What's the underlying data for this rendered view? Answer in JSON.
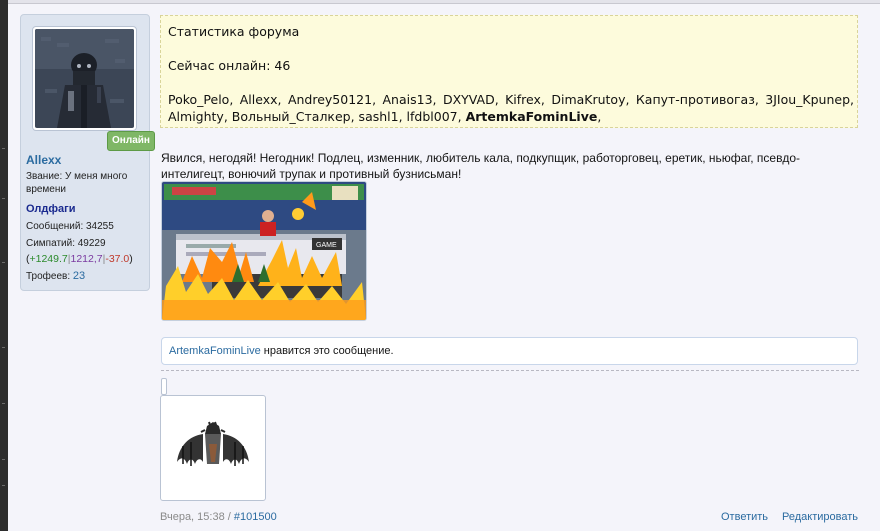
{
  "user": {
    "name": "Allexx",
    "status_label": "Звание: У меня много времени",
    "group": "Олдфаги",
    "messages": "Сообщений: 34255",
    "likes": "Симпатий: 49229",
    "rep_open": "(",
    "rep_plus": "+1249.7",
    "rep_mid": "1212,7",
    "rep_minus": "-37.0",
    "rep_close": ")",
    "rep_sep": "|",
    "trophies_label": "Трофеев: ",
    "trophies_value": "23",
    "online_badge": "Онлайн"
  },
  "stats": {
    "title": "Статистика форума",
    "online_now": "Сейчас онлайн: 46",
    "users_plain": "Poko_Pelo, Allexx, Andrey50121, Anais13, DXYVAD, Kifrex, DimaKrutoy, Капут-противогаз, 3JIou_Kpunep, Almighty, Вольный_Сталкер, sashl1, lfdbl007, ",
    "users_bold": "ArtemkaFominLive",
    "users_end": ","
  },
  "post": {
    "text": "Явился, негодяй! Негодник! Подлец, изменник, любитель кала, подкупщик, работорговец, еретик, ньюфаг, псевдо-интелигецт, вонючий трупак и противный бузнисьман!",
    "image_caption": "GAME"
  },
  "likes": {
    "user": "ArtemkaFominLive",
    "text": " нравится это сообщение."
  },
  "footer": {
    "date": "Вчера, 15:38 / ",
    "post_id": "#101500",
    "reply": "Ответить",
    "edit": "Редактировать"
  },
  "colors": {
    "link": "#2b6ba0",
    "online_badge": "#7fb766",
    "stats_bg": "#fdfbdc"
  }
}
